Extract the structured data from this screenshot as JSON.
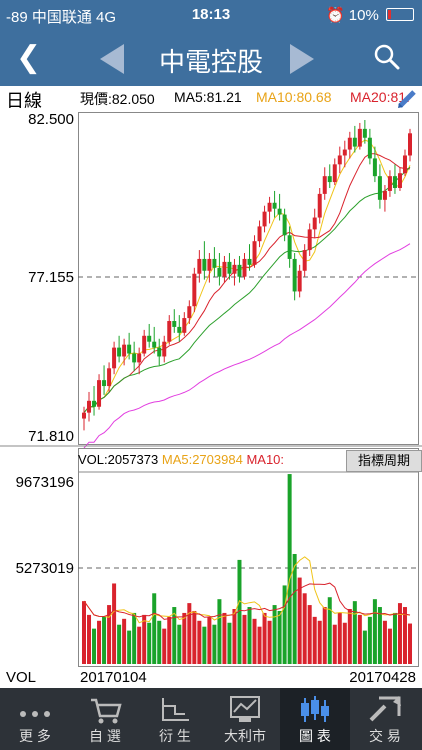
{
  "status": {
    "signal": "-89 中国联通  4G",
    "time": "18:13",
    "battery": "10%"
  },
  "nav": {
    "title": "中電控股"
  },
  "info": {
    "period": "日線",
    "price_label": "現價:82.050",
    "ma5": "MA5:81.21",
    "ma10": "MA10:80.68",
    "ma20": "MA20:81.",
    "colors": {
      "ma5": "#d79b00",
      "ma10": "#e8a317",
      "ma20": "#d9232d"
    }
  },
  "price_axis": {
    "top": "82.500",
    "mid": "77.155",
    "bottom": "71.810"
  },
  "vol_axis": {
    "top": "9673196",
    "mid": "5273019"
  },
  "vol_info": {
    "vol": "VOL:2057373",
    "ma5": "MA5:2703984",
    "ma10": "MA10:"
  },
  "indicator_button": "指標周期",
  "bottom": {
    "vol": "VOL",
    "start_date": "20170104",
    "end_date": "20170428"
  },
  "tabs": [
    {
      "label": "更 多",
      "icon": "more-icon"
    },
    {
      "label": "自 選",
      "icon": "cart-icon"
    },
    {
      "label": "衍 生",
      "icon": "derivative-icon"
    },
    {
      "label": "大利市",
      "icon": "market-monitor-icon"
    },
    {
      "label": "圖 表",
      "icon": "candlestick-icon",
      "active": true
    },
    {
      "label": "交 易",
      "icon": "trade-icon"
    }
  ],
  "chart_data": {
    "type": "candlestick",
    "x_range": [
      "20170104",
      "20170428"
    ],
    "price_ylim": [
      71.81,
      82.5
    ],
    "price_reference": 77.155,
    "volume_ylim": [
      0,
      9673196
    ],
    "volume_reference": 5273019,
    "last_close": 82.05,
    "candles": [
      [
        72.4,
        72.8,
        72.0,
        72.6,
        1
      ],
      [
        72.6,
        73.3,
        72.3,
        73.0,
        1
      ],
      [
        73.0,
        73.5,
        72.5,
        72.8,
        0
      ],
      [
        72.8,
        73.9,
        72.7,
        73.7,
        1
      ],
      [
        73.7,
        74.2,
        73.2,
        73.5,
        0
      ],
      [
        73.5,
        74.3,
        73.3,
        74.1,
        1
      ],
      [
        74.1,
        75.0,
        73.9,
        74.8,
        1
      ],
      [
        74.8,
        75.2,
        74.3,
        74.5,
        0
      ],
      [
        74.5,
        75.1,
        74.2,
        74.9,
        1
      ],
      [
        74.9,
        75.3,
        74.4,
        74.6,
        0
      ],
      [
        74.6,
        75.0,
        74.0,
        74.3,
        0
      ],
      [
        74.3,
        74.8,
        73.9,
        74.6,
        1
      ],
      [
        74.6,
        75.4,
        74.5,
        75.2,
        1
      ],
      [
        75.2,
        75.6,
        74.8,
        75.0,
        0
      ],
      [
        75.0,
        75.5,
        74.6,
        74.8,
        0
      ],
      [
        74.8,
        75.1,
        74.2,
        74.5,
        0
      ],
      [
        74.5,
        75.2,
        74.3,
        75.0,
        1
      ],
      [
        75.0,
        75.9,
        74.9,
        75.7,
        1
      ],
      [
        75.7,
        76.1,
        75.3,
        75.5,
        0
      ],
      [
        75.5,
        75.9,
        75.0,
        75.3,
        0
      ],
      [
        75.3,
        76.0,
        75.2,
        75.8,
        1
      ],
      [
        75.8,
        76.4,
        75.6,
        76.2,
        1
      ],
      [
        76.2,
        77.5,
        76.0,
        77.3,
        1
      ],
      [
        77.3,
        78.1,
        77.0,
        77.8,
        1
      ],
      [
        77.8,
        78.4,
        77.1,
        77.4,
        0
      ],
      [
        77.4,
        78.0,
        77.0,
        77.8,
        1
      ],
      [
        77.8,
        78.2,
        77.2,
        77.5,
        0
      ],
      [
        77.5,
        78.0,
        76.9,
        77.2,
        0
      ],
      [
        77.2,
        77.9,
        77.0,
        77.7,
        1
      ],
      [
        77.7,
        78.0,
        77.1,
        77.3,
        0
      ],
      [
        77.3,
        77.8,
        76.9,
        77.6,
        1
      ],
      [
        77.6,
        77.9,
        77.0,
        77.2,
        0
      ],
      [
        77.2,
        78.0,
        77.1,
        77.8,
        1
      ],
      [
        77.8,
        78.3,
        77.4,
        77.6,
        0
      ],
      [
        77.6,
        78.6,
        77.5,
        78.4,
        1
      ],
      [
        78.4,
        79.1,
        78.2,
        78.9,
        1
      ],
      [
        78.9,
        79.6,
        78.7,
        79.4,
        1
      ],
      [
        79.4,
        79.9,
        79.0,
        79.7,
        1
      ],
      [
        79.7,
        80.1,
        79.2,
        79.5,
        0
      ],
      [
        79.5,
        80.0,
        79.1,
        79.3,
        0
      ],
      [
        79.3,
        79.5,
        78.4,
        78.6,
        0
      ],
      [
        78.6,
        78.9,
        77.5,
        77.8,
        0
      ],
      [
        77.8,
        78.0,
        76.4,
        76.7,
        0
      ],
      [
        76.7,
        77.6,
        76.5,
        77.4,
        1
      ],
      [
        77.4,
        78.3,
        77.2,
        78.1,
        1
      ],
      [
        78.1,
        79.0,
        77.9,
        78.8,
        1
      ],
      [
        78.8,
        79.5,
        78.5,
        79.2,
        1
      ],
      [
        79.2,
        80.2,
        79.0,
        80.0,
        1
      ],
      [
        80.0,
        80.9,
        79.8,
        80.6,
        1
      ],
      [
        80.6,
        81.0,
        80.2,
        80.4,
        0
      ],
      [
        80.4,
        81.2,
        80.3,
        81.0,
        1
      ],
      [
        81.0,
        81.6,
        80.7,
        81.3,
        1
      ],
      [
        81.3,
        81.8,
        80.9,
        81.5,
        1
      ],
      [
        81.5,
        82.1,
        81.2,
        81.9,
        1
      ],
      [
        81.9,
        82.3,
        81.4,
        81.6,
        0
      ],
      [
        81.6,
        82.4,
        81.5,
        82.2,
        1
      ],
      [
        82.2,
        82.5,
        81.7,
        81.9,
        0
      ],
      [
        81.9,
        82.2,
        81.0,
        81.2,
        0
      ],
      [
        81.2,
        81.6,
        80.4,
        80.6,
        0
      ],
      [
        80.6,
        81.0,
        79.5,
        79.8,
        0
      ],
      [
        79.8,
        80.3,
        79.4,
        80.1,
        1
      ],
      [
        80.1,
        80.8,
        79.9,
        80.6,
        1
      ],
      [
        80.6,
        81.0,
        80.0,
        80.2,
        0
      ],
      [
        80.2,
        80.9,
        80.1,
        80.7,
        1
      ],
      [
        80.7,
        81.5,
        80.6,
        81.3,
        1
      ],
      [
        81.3,
        82.2,
        81.1,
        82.05,
        1
      ]
    ],
    "volume": [
      3.2,
      2.5,
      1.8,
      2.2,
      2.4,
      3.0,
      4.1,
      2.0,
      2.3,
      1.7,
      2.6,
      1.9,
      2.5,
      2.1,
      3.6,
      2.2,
      1.8,
      2.4,
      2.9,
      2.0,
      2.6,
      3.1,
      2.7,
      2.2,
      1.9,
      2.4,
      2.0,
      3.3,
      2.6,
      2.1,
      2.8,
      5.3,
      2.5,
      2.9,
      2.3,
      1.9,
      2.6,
      2.2,
      3.0,
      2.7,
      4.0,
      9.67,
      5.6,
      4.4,
      3.6,
      3.0,
      2.4,
      2.2,
      2.9,
      3.4,
      2.0,
      2.6,
      2.1,
      2.8,
      3.2,
      2.5,
      1.7,
      2.4,
      3.3,
      2.9,
      2.2,
      1.8,
      2.6,
      3.1,
      2.9,
      2.06
    ]
  }
}
